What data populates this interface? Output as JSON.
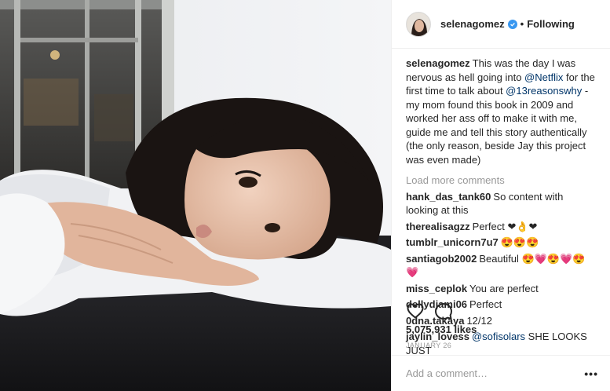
{
  "post": {
    "author": "selenagomez",
    "follow_status": "Following",
    "caption": {
      "user": "selenagomez",
      "parts": [
        {
          "text": "This was the day I was nervous as hell going into ",
          "mention": false
        },
        {
          "text": "@Netflix",
          "mention": true
        },
        {
          "text": " for the first time to talk about ",
          "mention": false
        },
        {
          "text": "@13reasonswhy",
          "mention": true
        },
        {
          "text": " -my mom found this book in 2009 and worked her ass off to make it with me, guide me and tell this story authentically (the only reason, beside Jay this project was even made)",
          "mention": false
        }
      ]
    },
    "load_more": "Load more comments",
    "comments": [
      {
        "user": "hank_das_tank60",
        "text": "So content with looking at this"
      },
      {
        "user": "therealisagzz",
        "text": "Perfect ❤👌❤"
      },
      {
        "user": "tumblr_unicorn7u7",
        "text": "😍😍😍"
      },
      {
        "user": "santiagob2002",
        "text": "Beautiful 😍💗😍💗😍💗"
      },
      {
        "user": "miss_ceplok",
        "text": "You are perfect"
      },
      {
        "user": "dellydjami06",
        "text": "Perfect"
      },
      {
        "user": "0dna.takaya",
        "text": "12/12"
      },
      {
        "user": "jaylin_lovess",
        "mention": "@sofisolars",
        "text": " SHE LOOKS JUST"
      }
    ],
    "likes": "5,075,931 likes",
    "date": "JANUARY 26",
    "add_comment_placeholder": "Add a comment…",
    "more_options": "•••"
  },
  "colors": {
    "verified": "#3897f0",
    "mention": "#003569",
    "muted": "#999999"
  },
  "icons": [
    "verified-badge-icon",
    "heart-icon",
    "comment-icon",
    "more-options-icon"
  ]
}
